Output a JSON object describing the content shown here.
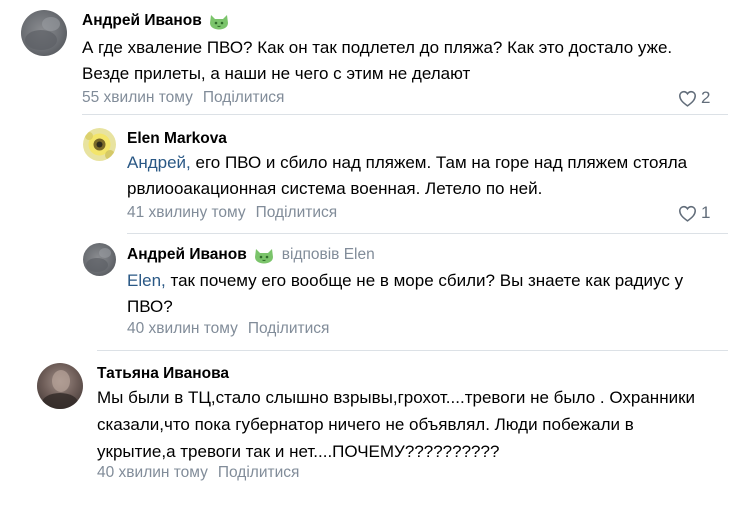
{
  "comments": [
    {
      "author": "Андрей Иванов",
      "text_lines": [
        "А где хваление ПВО? Как он так подлетел до пляжа? Как это достало уже.",
        "Везде прилеты, а наши не чего с этим не делают"
      ],
      "time": "55 хвилин тому",
      "share": "Поділитися",
      "likes": "2",
      "badge_icon": "cat-face-icon"
    },
    {
      "author": "Elen Markova",
      "mention": "Андрей,",
      "text_lines": [
        " его ПВО и сбило над пляжем. Там на горе над пляжем стояла",
        "рвлиооакационная система военная. Летело по ней."
      ],
      "time": "41 хвилину тому",
      "share": "Поділитися",
      "likes": "1"
    },
    {
      "author": "Андрей Иванов",
      "reply_to": "відповів Elen",
      "mention": "Elen,",
      "text_lines": [
        " так почему его вообще не в море сбили? Вы знаете как радиус у",
        "ПВО?"
      ],
      "time": "40 хвилин тому",
      "share": "Поділитися",
      "badge_icon": "cat-face-icon"
    },
    {
      "author": "Татьяна Иванова",
      "text_lines": [
        "Мы были в ТЦ,стало слышно взрывы,грохот....тревоги не было . Охранники",
        "сказали,что пока губернатор ничего не объявлял. Люди побежали в",
        "укрытие,а тревоги так и нет....ПОЧЕМУ??????????"
      ],
      "time": "40 хвилин тому",
      "share": "Поділитися"
    }
  ],
  "colors": {
    "meta_gray": "#818c99",
    "link_blue": "#2a5885",
    "like_gray": "#626d7a",
    "divider": "#dce1e6",
    "badge_green": "#7bc46b"
  }
}
